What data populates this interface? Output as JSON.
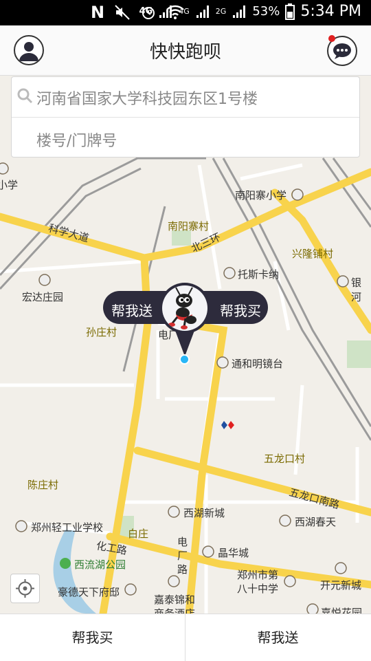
{
  "status_bar": {
    "network_left": "N",
    "network_4g": "4G",
    "network_4g_small": "4G",
    "network_2g": "2G",
    "battery": "53%",
    "time": "5:34 PM"
  },
  "app_bar": {
    "title": "快快跑呗",
    "notification_dot_color": "#e02020"
  },
  "search": {
    "address": "河南省国家大学科技园东区1号楼",
    "floor_placeholder": "楼号/门牌号"
  },
  "pin": {
    "left_label": "帮我送",
    "right_label": "帮我买"
  },
  "map_labels": {
    "xiaoxue": "小学",
    "nanyangzhai_xiaoxue": "南阳寨小学",
    "nanyangzhai_cun": "南阳寨村",
    "kexue_dadao": "科学大道",
    "beisanhuan": "北三环",
    "xinglong_pu": "兴隆铺村",
    "tuosikana": "托斯卡纳",
    "yinhe": "银河",
    "hongda_zhuangyuan": "宏达庄园",
    "sunzhuang": "孙庄村",
    "dianchang_lu_top": "电厂路",
    "tonghe_mingjingtai": "通和明镜台",
    "wulongkou_cun": "五龙口村",
    "chenzhuang": "陈庄村",
    "wulongkou_nanlu": "五龙口南路",
    "xihu_xincheng": "西湖新城",
    "xihu_chuntian": "西湖春天",
    "zhengzhou_qinggong": "郑州轻工业学校",
    "baizhuang": "白庄",
    "huagong_lu": "化工路",
    "jinghua_cheng": "晶华城",
    "dianchang_lu": "电厂路",
    "xiliuhu_gongyuan": "西流湖公园",
    "zhengzhou_80": "郑州市第八十中学",
    "kaiyuan_xincheng": "开元新城",
    "haode_tianxia": "豪德天下府邸",
    "jiatai_jinhe": "嘉泰锦和商务酒店",
    "jiayue_huayuan": "嘉悦花园"
  },
  "bottom_bar": {
    "left": "帮我买",
    "right": "帮我送"
  }
}
